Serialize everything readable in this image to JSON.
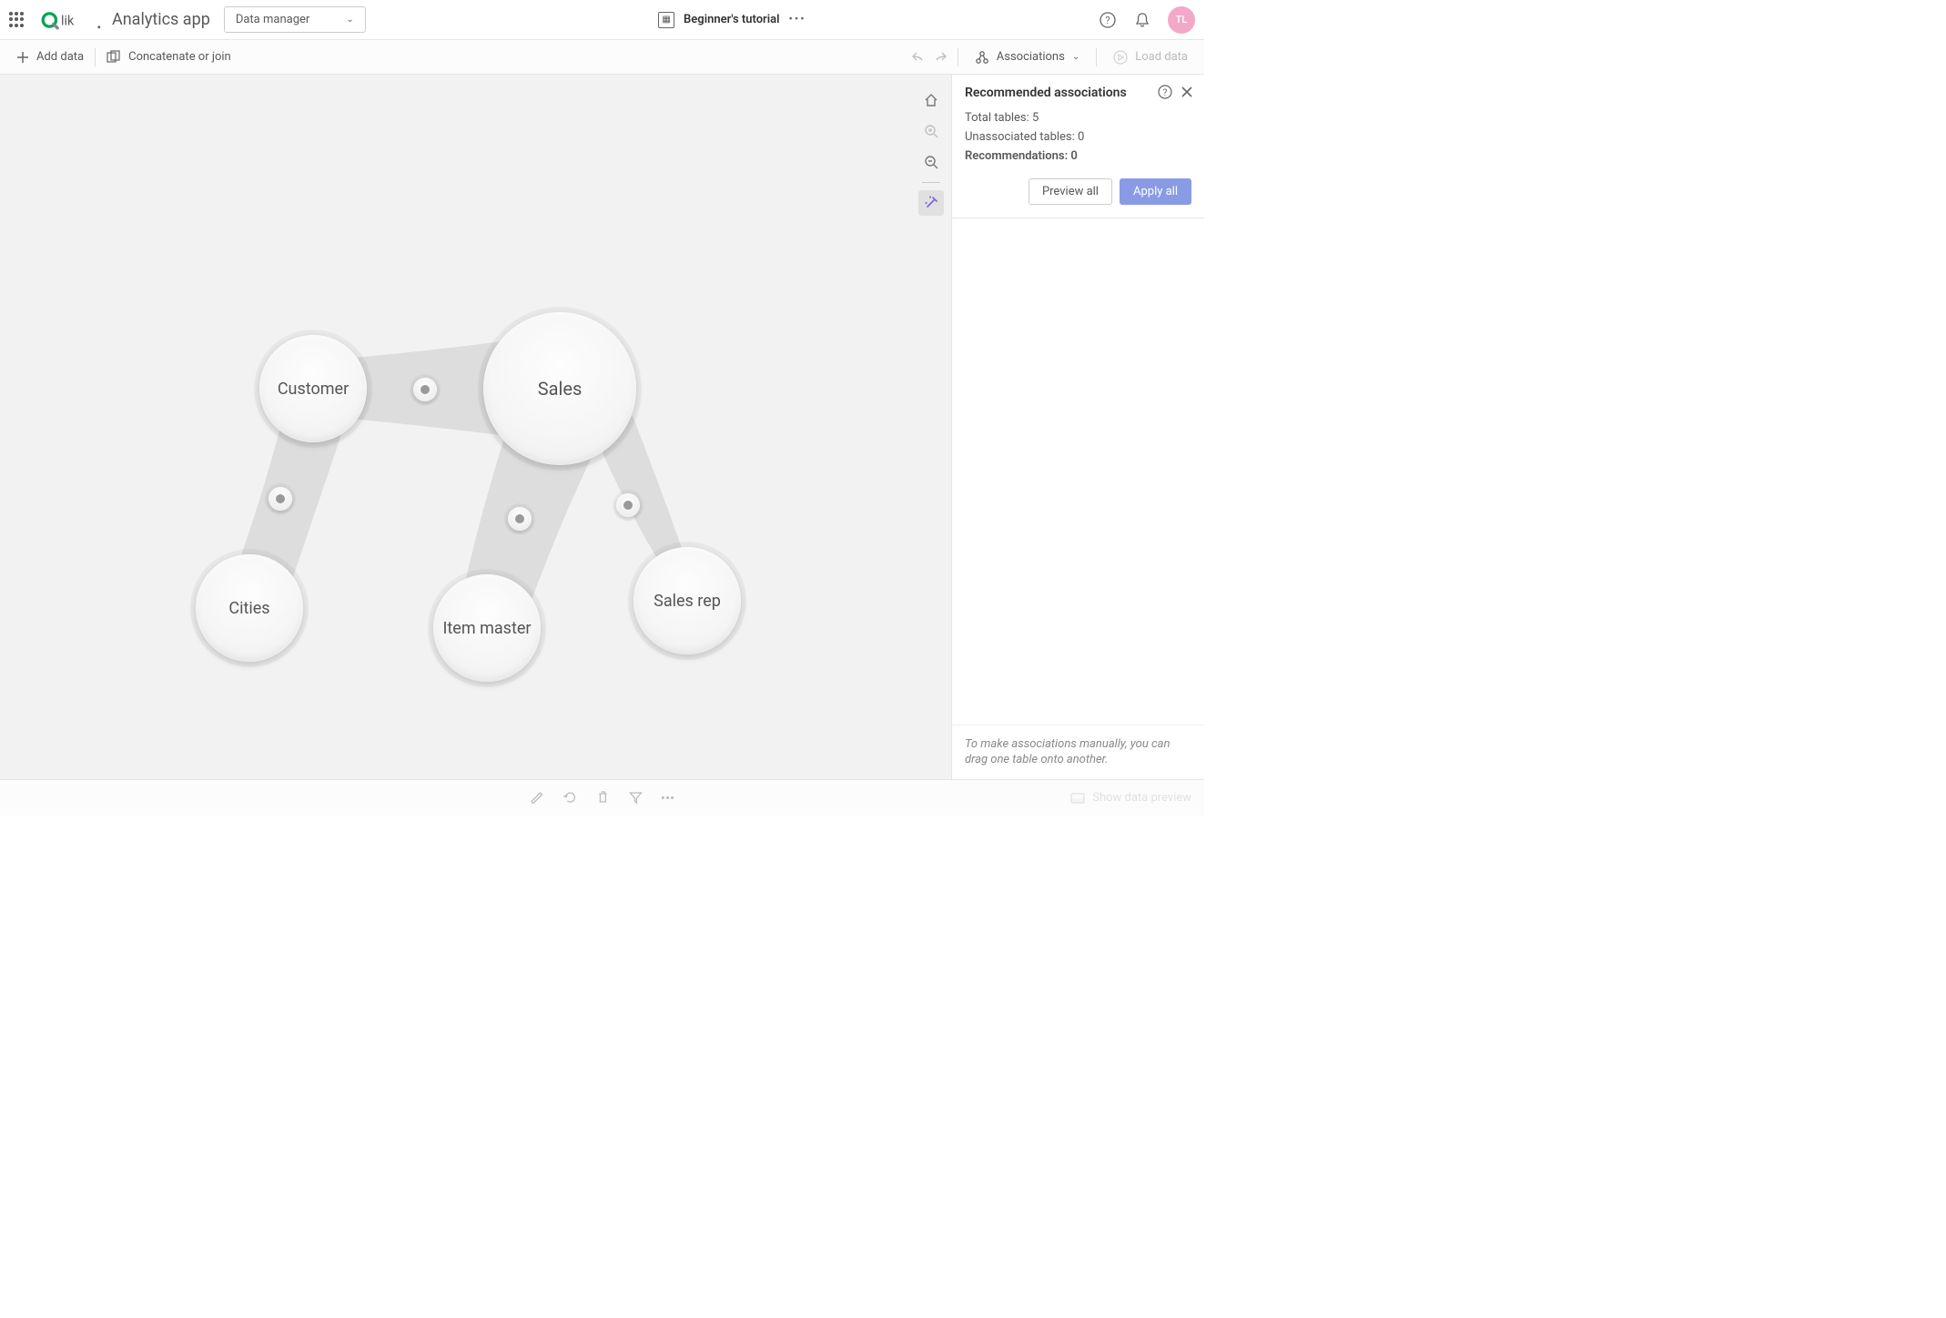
{
  "header": {
    "app_name": "Analytics app",
    "dropdown_label": "Data manager",
    "tutorial_name": "Beginner's tutorial",
    "avatar_initials": "TL"
  },
  "toolbar": {
    "add_data": "Add data",
    "concat_join": "Concatenate or join",
    "associations": "Associations",
    "load_data": "Load data"
  },
  "bubbles": {
    "customer": "Customer",
    "sales": "Sales",
    "cities": "Cities",
    "item_master": "Item master",
    "sales_rep": "Sales rep"
  },
  "panel": {
    "title": "Recommended associations",
    "total_tables_label": "Total tables: ",
    "total_tables_value": "5",
    "unassoc_label": "Unassociated tables: ",
    "unassoc_value": "0",
    "recs_label": "Recommendations: ",
    "recs_value": "0",
    "preview_all": "Preview all",
    "apply_all": "Apply all",
    "footer_hint": "To make associations manually, you can drag one table onto another."
  },
  "footer": {
    "show_preview": "Show data preview"
  }
}
